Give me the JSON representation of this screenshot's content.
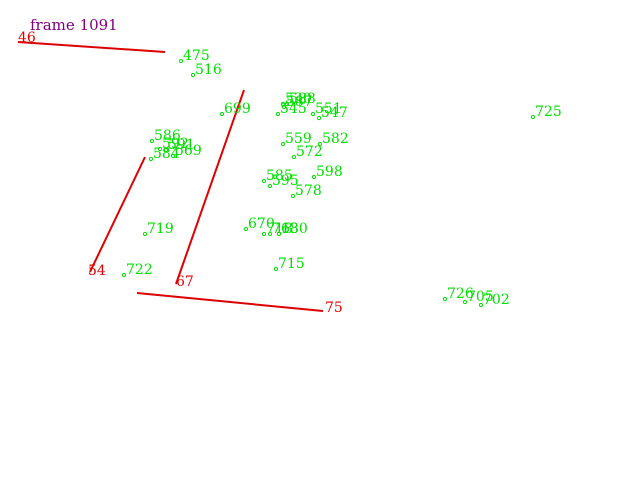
{
  "frame_label": "frame 1091",
  "colors": {
    "title": "#800080",
    "segment": "#dd0000",
    "point": "#00dd00"
  },
  "segments": [
    {
      "id": "46"
    },
    {
      "id": "54"
    },
    {
      "id": "67"
    },
    {
      "id": "75"
    }
  ],
  "points": [
    {
      "id": "475"
    },
    {
      "id": "516"
    },
    {
      "id": "699"
    },
    {
      "id": "530"
    },
    {
      "id": "588"
    },
    {
      "id": "587"
    },
    {
      "id": "545"
    },
    {
      "id": "551"
    },
    {
      "id": "547"
    },
    {
      "id": "725"
    },
    {
      "id": "586"
    },
    {
      "id": "591"
    },
    {
      "id": "592"
    },
    {
      "id": "569"
    },
    {
      "id": "584"
    },
    {
      "id": "559"
    },
    {
      "id": "582"
    },
    {
      "id": "572"
    },
    {
      "id": "585"
    },
    {
      "id": "595"
    },
    {
      "id": "598"
    },
    {
      "id": "578"
    },
    {
      "id": "719"
    },
    {
      "id": "670"
    },
    {
      "id": "718"
    },
    {
      "id": "713"
    },
    {
      "id": "680"
    },
    {
      "id": "715"
    },
    {
      "id": "722"
    },
    {
      "id": "726"
    },
    {
      "id": "705"
    },
    {
      "id": "702"
    }
  ]
}
